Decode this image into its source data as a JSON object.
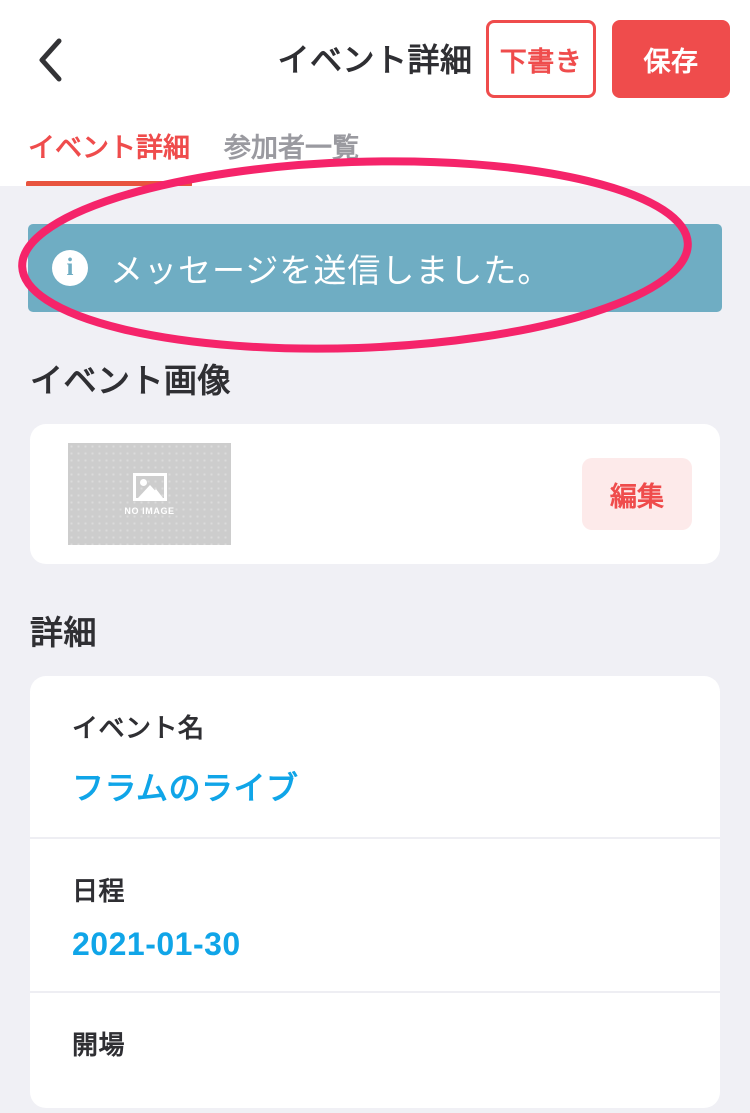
{
  "header": {
    "back_icon": "chevron-left-icon",
    "title": "イベント詳細",
    "draft_label": "下書き",
    "save_label": "保存",
    "accent_red": "#ef4c4c"
  },
  "tabs": [
    {
      "label": "イベント詳細",
      "active": true
    },
    {
      "label": "参加者一覧",
      "active": false
    }
  ],
  "alert": {
    "icon": "info-circle-icon",
    "message": "メッセージを送信しました。",
    "background": "#6fadc3",
    "text_color": "#ffffff"
  },
  "image_section": {
    "title": "イベント画像",
    "placeholder_icon": "photo-placeholder-icon",
    "placeholder_label": "NO IMAGE",
    "edit_label": "編集",
    "edit_bg": "#fdeaea",
    "edit_color": "#ef4c4c"
  },
  "detail_section": {
    "title": "詳細",
    "rows": [
      {
        "label": "イベント名",
        "value": "フラムのライブ"
      },
      {
        "label": "日程",
        "value": "2021-01-30"
      },
      {
        "label": "開場",
        "value": ""
      }
    ],
    "value_color": "#10a5e8"
  },
  "annotation": {
    "type": "ellipse-highlight",
    "color": "#f5246a",
    "stroke_width": 8
  },
  "theme": {
    "page_background": "#f0f0f5",
    "card_background": "#ffffff",
    "text_primary": "#2f2f33",
    "text_muted": "#9a9aa0"
  }
}
